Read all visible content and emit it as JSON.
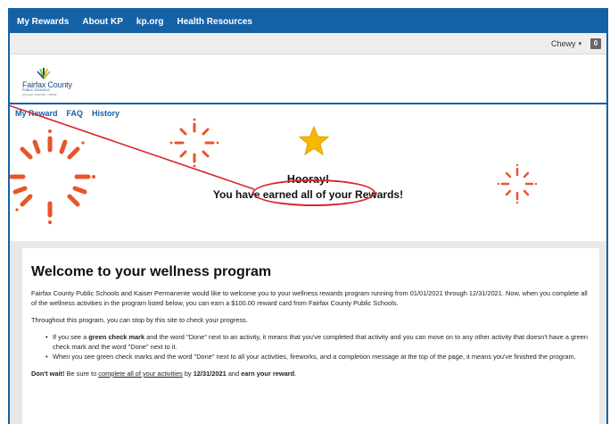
{
  "topnav": {
    "items": [
      "My Rewards",
      "About KP",
      "kp.org",
      "Health Resources"
    ]
  },
  "userbar": {
    "user_name": "Chewy",
    "caret": "▾",
    "cart_count": "0"
  },
  "logo": {
    "name": "Fairfax County",
    "sub": "PUBLIC SCHOOLS",
    "tag": "ENGAGE • INSPIRE • THRIVE"
  },
  "tabs": [
    "My Reward",
    "FAQ",
    "History"
  ],
  "banner": {
    "hooray": "Hooray!",
    "message": "You have earned all of your Rewards!",
    "star_color": "#f5b800",
    "firework_color": "#e8552a",
    "callout_color": "#d7262a"
  },
  "welcome": {
    "title": "Welcome to your wellness program",
    "intro": "Fairfax County Public Schools and Kaiser Permanente would like to welcome you to your wellness rewards program running from 01/01/2021 through 12/31/2021. Now, when you complete all of the wellness activities in the program listed below, you can earn a $100.00 reward card from Fairfax County Public Schools.",
    "progress_note": "Throughout this program, you can stop by this site to check your progress.",
    "bullets": [
      {
        "pre": "If you see a ",
        "bold": "green check mark",
        "post": " and the word \"Done\" next to an activity, it means that you've completed that activity and you can move on to any other activity that doesn't have a green check mark and the word \"Done\" next to it."
      },
      {
        "pre": "When you see green check marks and the word \"Done\" next to all your activities, fireworks, and a completion message at the top of the page, it means you've finished the program.",
        "bold": "",
        "post": ""
      }
    ],
    "cta": {
      "bold1": "Don't wait!",
      "text1": " Be sure to ",
      "link": "complete all of your activities",
      "text2": " by ",
      "date": "12/31/2021",
      "text3": " and ",
      "bold2": "earn your reward",
      "end": "."
    }
  }
}
